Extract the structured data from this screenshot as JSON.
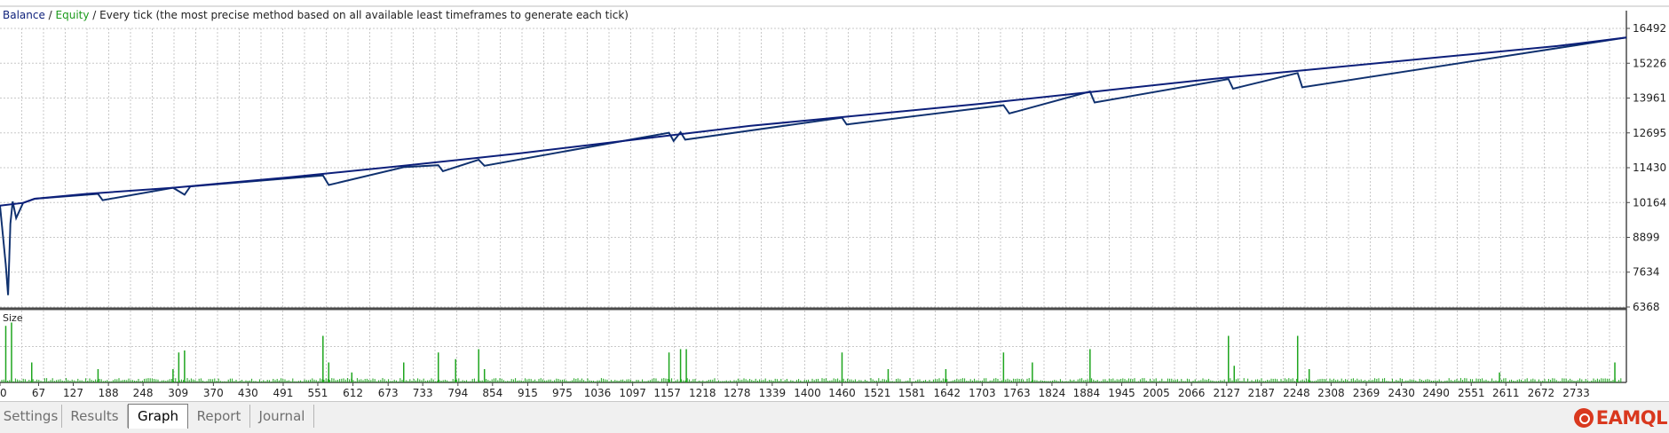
{
  "chart_title": {
    "balance": "Balance",
    "sep1": " / ",
    "equity": "Equity",
    "rest": " / Every tick (the most precise method based on all available least timeframes to generate each tick)"
  },
  "size_label": "Size",
  "colors": {
    "balance": "#0c1f7a",
    "equity": "#1a9a1a",
    "size_bars": "#1ea51e",
    "grid": "#c8c8c8",
    "frame": "#4a4a4a"
  },
  "tabs": [
    {
      "label": "Settings",
      "active": false
    },
    {
      "label": "Results",
      "active": false
    },
    {
      "label": "Graph",
      "active": true
    },
    {
      "label": "Report",
      "active": false
    },
    {
      "label": "Journal",
      "active": false
    }
  ],
  "logo": {
    "text": "EAMQL",
    "icon": "eamql-logo-icon"
  },
  "chart_data": {
    "type": "line",
    "title": "Balance / Equity / Every tick (the most precise method based on all available least timeframes to generate each tick)",
    "y_ticks": [
      16492,
      15226,
      13961,
      12695,
      11430,
      10164,
      8899,
      7634,
      6368
    ],
    "ylim": [
      6368,
      16492
    ],
    "x_ticks": [
      0,
      67,
      127,
      188,
      248,
      309,
      370,
      430,
      491,
      551,
      612,
      673,
      733,
      794,
      854,
      915,
      975,
      1036,
      1097,
      1157,
      1218,
      1278,
      1339,
      1400,
      1460,
      1521,
      1581,
      1642,
      1703,
      1763,
      1824,
      1884,
      1945,
      2005,
      2066,
      2127,
      2187,
      2248,
      2308,
      2369,
      2430,
      2490,
      2551,
      2611,
      2672,
      2733
    ],
    "xlim": [
      0,
      2820
    ],
    "grid": true,
    "series": [
      {
        "name": "Balance",
        "x": [
          0,
          40,
          60,
          150,
          300,
          500,
          700,
          900,
          1100,
          1300,
          1500,
          1700,
          1900,
          2100,
          2300,
          2500,
          2700,
          2820
        ],
        "y": [
          10050,
          10150,
          10300,
          10480,
          10700,
          11080,
          11500,
          11950,
          12450,
          12950,
          13350,
          13750,
          14200,
          14650,
          15050,
          15450,
          15850,
          16160
        ]
      },
      {
        "name": "Equity",
        "x": [
          0,
          5,
          10,
          14,
          18,
          22,
          28,
          40,
          60,
          170,
          178,
          300,
          320,
          330,
          560,
          570,
          700,
          760,
          768,
          830,
          840,
          1160,
          1168,
          1180,
          1188,
          1460,
          1468,
          1740,
          1750,
          1890,
          1898,
          2130,
          2138,
          2250,
          2258,
          2820
        ],
        "y": [
          10050,
          9000,
          7900,
          6800,
          9400,
          10200,
          9600,
          10150,
          10300,
          10480,
          10250,
          10700,
          10450,
          10750,
          11150,
          10800,
          11450,
          11520,
          11300,
          11720,
          11500,
          12700,
          12400,
          12720,
          12450,
          13250,
          13000,
          13700,
          13400,
          14200,
          13800,
          14650,
          14300,
          14870,
          14350,
          16160
        ]
      }
    ]
  },
  "size_chart_data": {
    "type": "bar",
    "ylabel": "Size",
    "spikes_x": [
      10,
      20,
      55,
      170,
      300,
      310,
      320,
      560,
      570,
      610,
      700,
      760,
      790,
      830,
      840,
      1160,
      1180,
      1190,
      1460,
      1540,
      1640,
      1740,
      1790,
      1890,
      2130,
      2140,
      2250,
      2270,
      2600,
      2800
    ],
    "spikes_h": [
      0.85,
      0.9,
      0.3,
      0.2,
      0.2,
      0.45,
      0.48,
      0.7,
      0.3,
      0.15,
      0.3,
      0.45,
      0.35,
      0.5,
      0.2,
      0.45,
      0.5,
      0.5,
      0.45,
      0.2,
      0.2,
      0.45,
      0.3,
      0.5,
      0.7,
      0.25,
      0.7,
      0.2,
      0.15,
      0.3
    ]
  }
}
